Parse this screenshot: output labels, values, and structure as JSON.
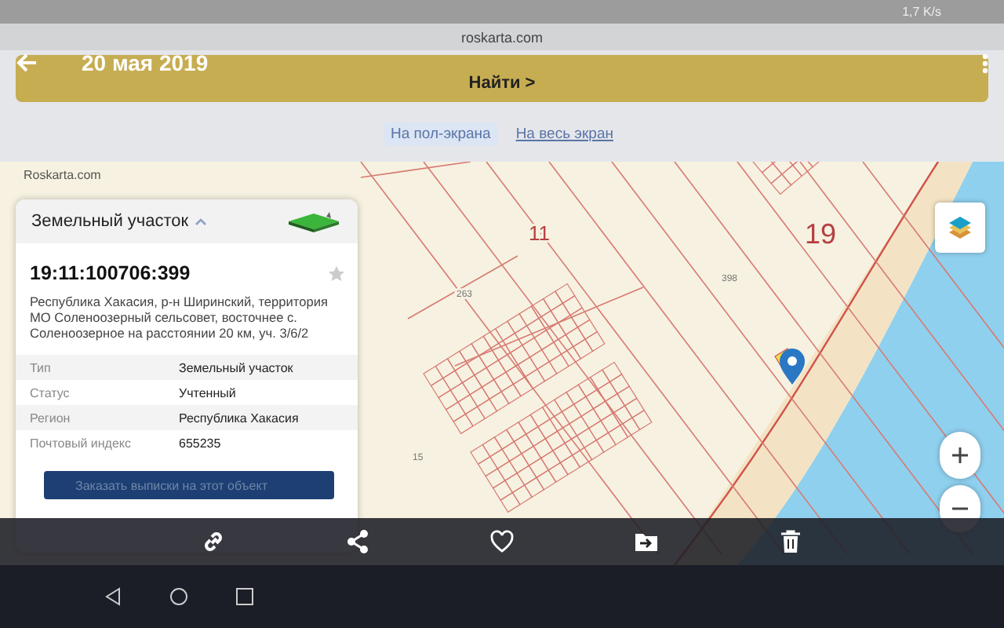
{
  "status_bar": {
    "speed": "1,7 K/s"
  },
  "browser": {
    "url": "roskarta.com"
  },
  "toolbar": {
    "date": "20 мая 2019"
  },
  "search_button": {
    "label": "Найти >"
  },
  "view_links": [
    {
      "label": "На пол-экрана",
      "selected": true
    },
    {
      "label": "На весь экран",
      "selected": false
    }
  ],
  "map": {
    "attribution": "Roskarta.com",
    "labels": [
      {
        "text": "11",
        "kind": "block"
      },
      {
        "text": "19",
        "kind": "block"
      },
      {
        "text": "263",
        "kind": "lot"
      },
      {
        "text": "398",
        "kind": "lot"
      },
      {
        "text": "15",
        "kind": "lot"
      }
    ]
  },
  "card": {
    "title": "Земельный участок",
    "number": "19:11:100706:399",
    "favorite": false,
    "address": "Республика Хакасия, р-н Ширинский, территория МО Соленоозерный сельсовет, восточнее с. Соленоозерное на расстоянии 20 км, уч. 3/6/2",
    "properties": [
      {
        "label": "Тип",
        "value": "Земельный участок"
      },
      {
        "label": "Статус",
        "value": "Учтенный"
      },
      {
        "label": "Регион",
        "value": "Республика Хакасия"
      },
      {
        "label": "Почтовый индекс",
        "value": "655235"
      }
    ],
    "order_button": "Заказать выписки на этот объект"
  }
}
